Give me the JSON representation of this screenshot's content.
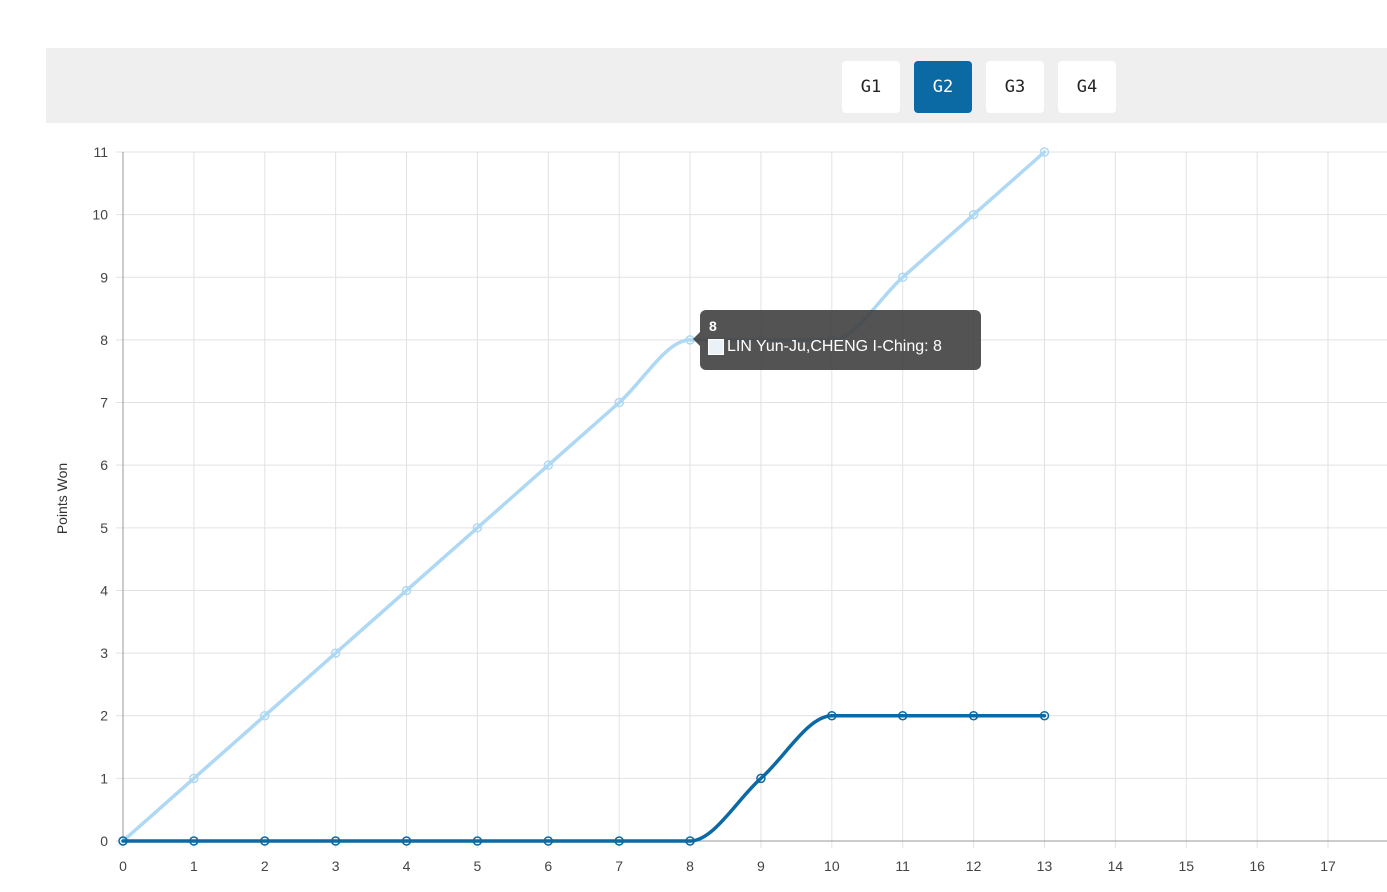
{
  "game_tabs": [
    {
      "label": "G1",
      "active": false
    },
    {
      "label": "G2",
      "active": true
    },
    {
      "label": "G3",
      "active": false
    },
    {
      "label": "G4",
      "active": false
    }
  ],
  "colors": {
    "light_series": "#aed8f3",
    "dark_series": "#0b69a3",
    "tab_active": "#0b69a3",
    "grid": "#e2e2e2"
  },
  "tooltip": {
    "title": "8",
    "label": "LIN Yun-Ju,CHENG I-Ching: 8"
  },
  "chart_data": {
    "type": "line",
    "title": "",
    "xlabel": "",
    "ylabel": "Points Won",
    "xlim": [
      0,
      17
    ],
    "ylim": [
      0,
      11
    ],
    "x_ticks": [
      0,
      1,
      2,
      3,
      4,
      5,
      6,
      7,
      8,
      9,
      10,
      11,
      12,
      13,
      14,
      15,
      16,
      17
    ],
    "y_ticks": [
      0,
      1,
      2,
      3,
      4,
      5,
      6,
      7,
      8,
      9,
      10,
      11
    ],
    "grid": true,
    "x": [
      0,
      1,
      2,
      3,
      4,
      5,
      6,
      7,
      8,
      9,
      10,
      11,
      12,
      13
    ],
    "series": [
      {
        "name": "LIN Yun-Ju,CHENG I-Ching",
        "color": "#aed8f3",
        "values": [
          0,
          1,
          2,
          3,
          4,
          5,
          6,
          7,
          8,
          8,
          8,
          9,
          10,
          11
        ]
      },
      {
        "name": "",
        "color": "#0b69a3",
        "values": [
          0,
          0,
          0,
          0,
          0,
          0,
          0,
          0,
          0,
          1,
          2,
          2,
          2,
          2
        ]
      }
    ]
  }
}
